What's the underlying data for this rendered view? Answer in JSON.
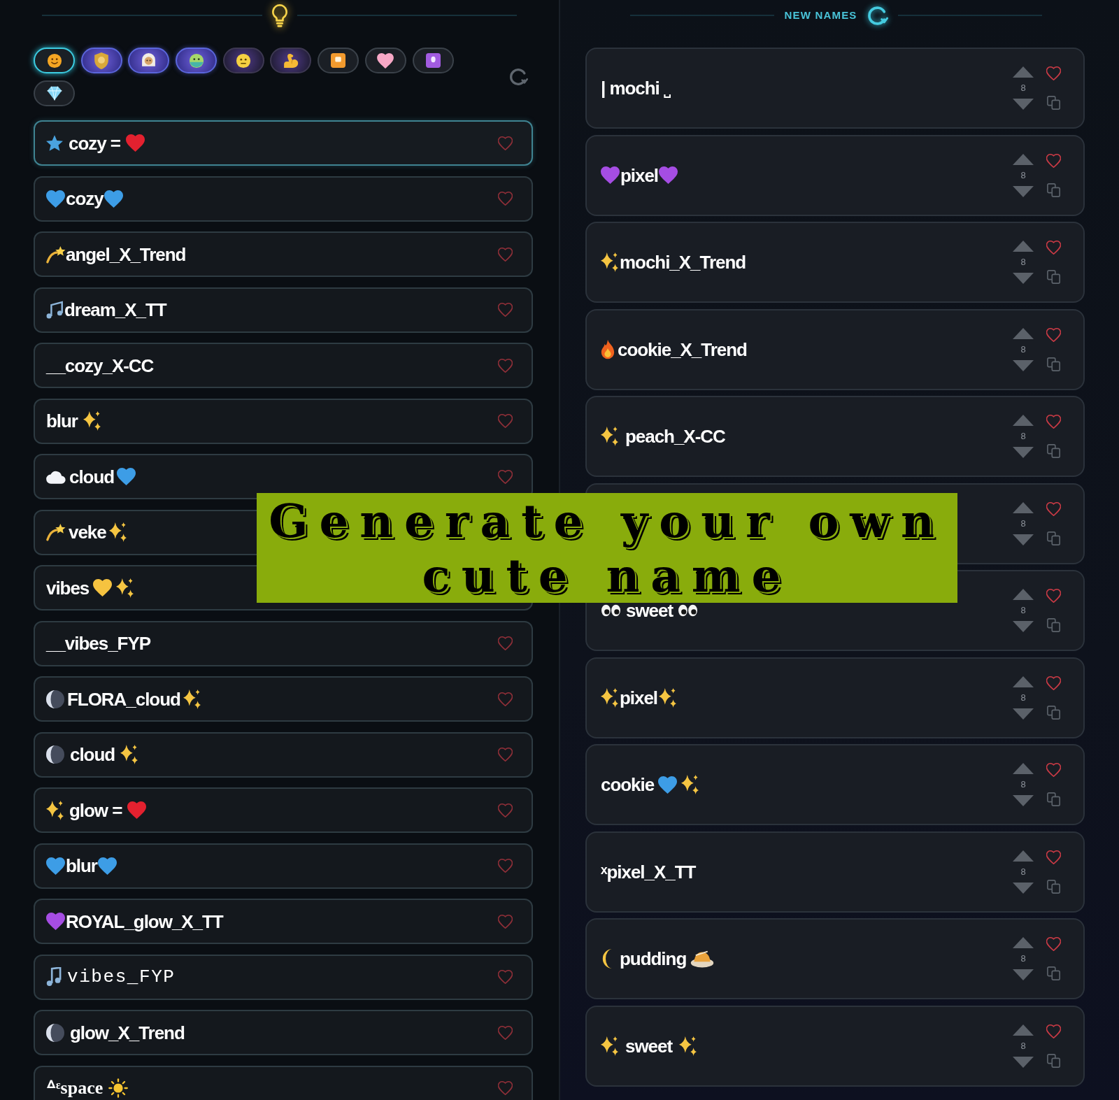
{
  "header": {
    "title": "NEW NAMES"
  },
  "categories": [
    {
      "kind": "plain",
      "selected": true
    },
    {
      "kind": "galaxy",
      "selected": false
    },
    {
      "kind": "galaxy",
      "selected": false
    },
    {
      "kind": "galaxy",
      "selected": false
    },
    {
      "kind": "nebula",
      "selected": false
    },
    {
      "kind": "nebula",
      "selected": false
    },
    {
      "kind": "plain",
      "selected": false
    },
    {
      "kind": "plain",
      "selected": false
    },
    {
      "kind": "plain",
      "selected": false
    },
    {
      "kind": "plain",
      "selected": false
    }
  ],
  "left_names": [
    {
      "name": "cozy =",
      "selected": true,
      "favorited": false
    },
    {
      "name": "cozy",
      "selected": false,
      "favorited": false
    },
    {
      "name": "angel_X_Trend",
      "selected": false,
      "favorited": false
    },
    {
      "name": "dream_X_TT",
      "selected": false,
      "favorited": false
    },
    {
      "name": "__cozy_X-CC",
      "selected": false,
      "favorited": false
    },
    {
      "name": "blur",
      "selected": false,
      "favorited": false
    },
    {
      "name": "cloud",
      "selected": false,
      "favorited": false
    },
    {
      "name": "veke",
      "selected": false
    },
    {
      "name": "vibes",
      "selected": false
    },
    {
      "name": "__vibes_FYP",
      "selected": false,
      "favorited": false
    },
    {
      "name": "FLORA_cloud",
      "selected": false,
      "favorited": false
    },
    {
      "name": "cloud",
      "selected": false,
      "favorited": false
    },
    {
      "name": "glow =",
      "selected": false,
      "favorited": false
    },
    {
      "name": "blur",
      "selected": false,
      "favorited": false
    },
    {
      "name": "ROYAL_glow_X_TT",
      "selected": false,
      "favorited": false
    },
    {
      "name": "vibes_FYP",
      "selected": false,
      "favorited": false
    },
    {
      "name": "glow_X_Trend",
      "selected": false,
      "favorited": false
    },
    {
      "name": "ᐞᵋspace",
      "selected": false,
      "favorited": false
    }
  ],
  "new_names": [
    {
      "name": "| mochi ˽",
      "votes": "8",
      "favorited": false
    },
    {
      "name": "pixel",
      "votes": "8",
      "favorited": false
    },
    {
      "name": "mochi_X_Trend",
      "votes": "8",
      "favorited": false
    },
    {
      "name": "cookie_X_Trend",
      "votes": "8",
      "favorited": false
    },
    {
      "name": "peach_X-CC",
      "votes": "8",
      "favorited": false
    },
    {
      "votes": "8",
      "favorited": false
    },
    {
      "name": "sweet",
      "votes": "8",
      "favorited": false
    },
    {
      "name": "pixel",
      "votes": "8",
      "favorited": false
    },
    {
      "name": "cookie",
      "votes": "8",
      "favorited": false
    },
    {
      "name": "ˣpixel_X_TT",
      "votes": "8",
      "favorited": false
    },
    {
      "name": "pudding",
      "votes": "8",
      "favorited": false
    },
    {
      "name": "sweet",
      "votes": "8",
      "favorited": false
    }
  ],
  "banner": {
    "title": "Generate your own cute name"
  }
}
